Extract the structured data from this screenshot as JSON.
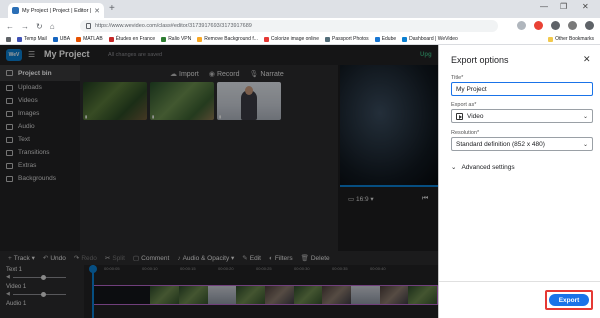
{
  "browser": {
    "tab_title": "My Project | Project | Editor | W",
    "url": "https://www.wevideo.com/class#editor/3173917693/3173917689",
    "bookmarks": [
      "Temp Mail",
      "UBA",
      "MATLAB",
      "Études en France",
      "Ralio VPN",
      "Remove Background f...",
      "Colorize image online",
      "Passport Photos",
      "Edube",
      "Dashboard | WeVideo"
    ],
    "other_bookmarks": "Other Bookmarks"
  },
  "editor": {
    "logo": "WeV",
    "project_title": "My Project",
    "save_status": "All changes are saved",
    "upgrade": "Upg"
  },
  "sidebar": {
    "items": [
      {
        "label": "Project bin"
      },
      {
        "label": "Uploads"
      },
      {
        "label": "Videos"
      },
      {
        "label": "Images"
      },
      {
        "label": "Audio"
      },
      {
        "label": "Text"
      },
      {
        "label": "Transitions"
      },
      {
        "label": "Extras"
      },
      {
        "label": "Backgrounds"
      }
    ]
  },
  "bin": {
    "actions": {
      "import": "Import",
      "record": "Record",
      "narrate": "Narrate"
    }
  },
  "preview": {
    "aspect_ratio": "16:9"
  },
  "timeline_toolbar": {
    "track": "Track",
    "undo": "Undo",
    "redo": "Redo",
    "split": "Split",
    "comment": "Comment",
    "audio_opacity": "Audio & Opacity",
    "edit": "Edit",
    "filters": "Filters",
    "delete": "Delete"
  },
  "timeline": {
    "ruler": [
      "00:00:00",
      "00:00:05",
      "00:00:10",
      "00:00:15",
      "00:00:20",
      "00:00:25",
      "00:00:30",
      "00:00:35",
      "00:00:40"
    ],
    "tracks": [
      {
        "label": "Text 1"
      },
      {
        "label": "Video 1"
      },
      {
        "label": "Audio 1"
      }
    ]
  },
  "export_panel": {
    "title": "Export options",
    "title_label": "Title*",
    "title_value": "My Project",
    "export_as_label": "Export as*",
    "export_as_value": "Video",
    "resolution_label": "Resolution*",
    "resolution_value": "Standard definition (852 x 480)",
    "advanced": "Advanced settings",
    "export_button": "Export"
  }
}
